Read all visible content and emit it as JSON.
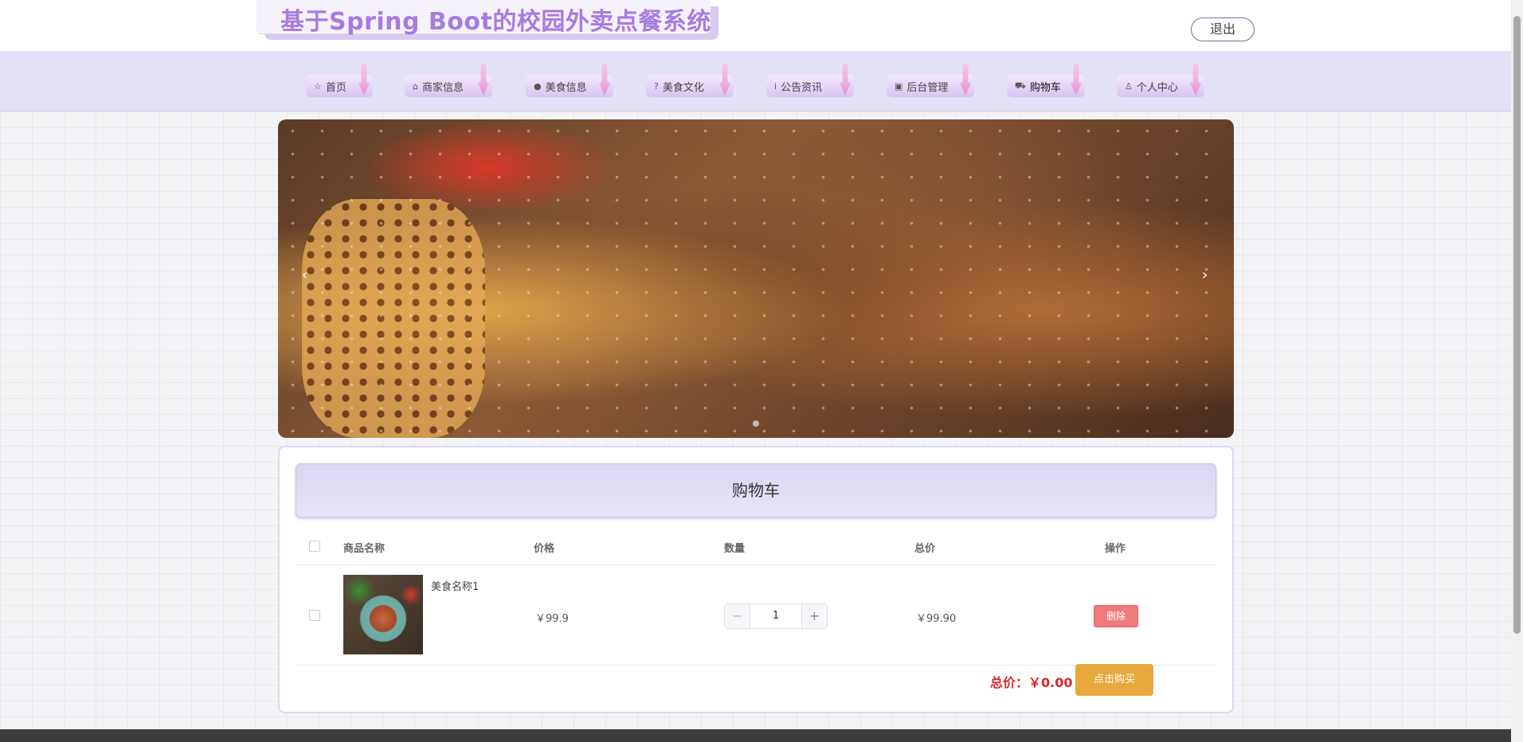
{
  "header": {
    "site_title": "基于Spring Boot的校园外卖点餐系统",
    "logout_label": "退出"
  },
  "nav": {
    "items": [
      {
        "label": "首页",
        "icon": "star-icon",
        "glyph": "☆"
      },
      {
        "label": "商家信息",
        "icon": "shop-icon",
        "glyph": "⌂"
      },
      {
        "label": "美食信息",
        "icon": "info-icon",
        "glyph": "●"
      },
      {
        "label": "美食文化",
        "icon": "question-icon",
        "glyph": "?"
      },
      {
        "label": "公告资讯",
        "icon": "info-circle-icon",
        "glyph": "i"
      },
      {
        "label": "后台管理",
        "icon": "briefcase-icon",
        "glyph": "▣"
      },
      {
        "label": "购物车",
        "icon": "cart-icon",
        "glyph": "⛟"
      },
      {
        "label": "个人中心",
        "icon": "user-icon",
        "glyph": "♙"
      }
    ],
    "active": "购物车"
  },
  "banner": {
    "prev_glyph": "‹",
    "next_glyph": "›"
  },
  "cart": {
    "title": "购物车",
    "columns": [
      "商品名称",
      "价格",
      "数量",
      "总价",
      "操作"
    ],
    "rows": [
      {
        "name": "美食名称1",
        "price": "￥99.9",
        "quantity": "1",
        "subtotal": "￥99.90",
        "delete_label": "删除"
      }
    ],
    "minus_glyph": "−",
    "plus_glyph": "+",
    "total_label": "总价：￥0.00",
    "buy_label": "点击购买"
  },
  "colors": {
    "title": "#a77be0",
    "nav_bg": "#e2e1f5",
    "delete": "#f07a7a",
    "buy": "#e8a83e",
    "total": "#d42a2a"
  }
}
